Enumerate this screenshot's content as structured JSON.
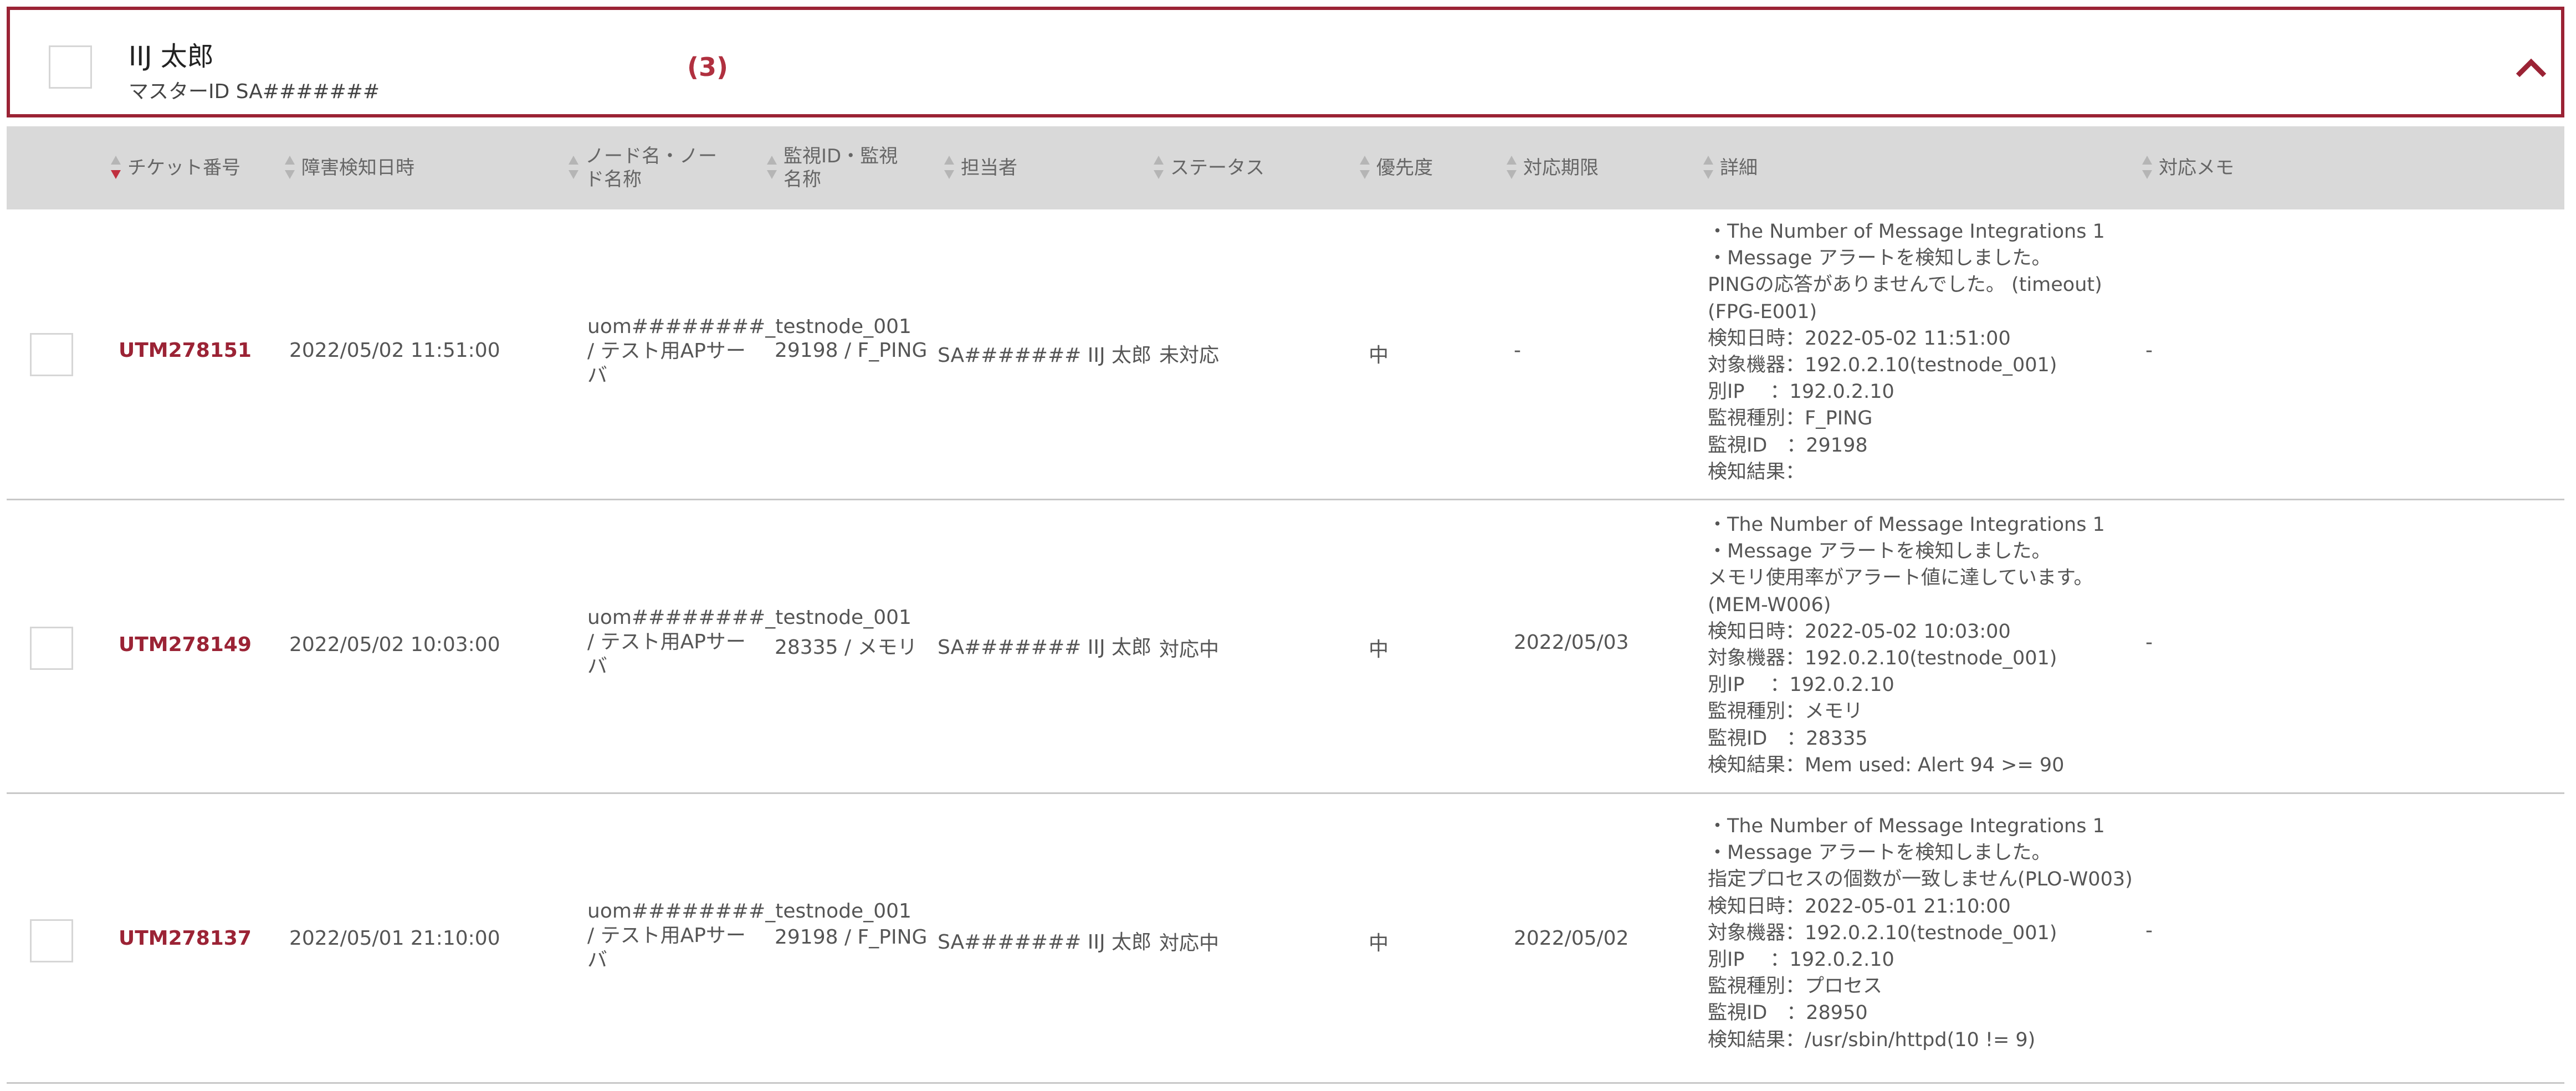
{
  "group": {
    "user_name": "IIJ 太郎",
    "master_id": "マスターID SA#######",
    "count": "(3)"
  },
  "columns": {
    "ticket": "チケット番号",
    "detected_at": "障害検知日時",
    "node": "ノード名・ノード名称",
    "monitor": "監視ID・監視名称",
    "assignee": "担当者",
    "status": "ステータス",
    "priority": "優先度",
    "deadline": "対応期限",
    "detail": "詳細",
    "memo": "対応メモ"
  },
  "rows": [
    {
      "ticket": "UTM278151",
      "detected_at": "2022/05/02 11:51:00",
      "node": "uom########_testnode_001 / テスト用APサーバ",
      "monitor": "29198 / F_PING",
      "assignee": "SA####### IIJ 太郎",
      "status": "未対応",
      "priority": "中",
      "deadline": "-",
      "detail": "・The Number of Message Integrations 1\n・Message アラートを検知しました。\nPINGの応答がありませんでした。 (timeout)\n(FPG-E001)\n検知日時：2022-05-02 11:51:00\n対象機器：192.0.2.10(testnode_001)\n別IP　 ：192.0.2.10\n監視種別：F_PING\n監視ID　：29198\n検知結果：",
      "memo": "-"
    },
    {
      "ticket": "UTM278149",
      "detected_at": "2022/05/02 10:03:00",
      "node": "uom########_testnode_001 / テスト用APサーバ",
      "monitor": "28335 / メモリ",
      "assignee": "SA####### IIJ 太郎",
      "status": "対応中",
      "priority": "中",
      "deadline": "2022/05/03",
      "detail": "・The Number of Message Integrations 1\n・Message アラートを検知しました。\nメモリ使用率がアラート値に達しています。\n(MEM-W006)\n検知日時：2022-05-02 10:03:00\n対象機器：192.0.2.10(testnode_001)\n別IP　 ：192.0.2.10\n監視種別：メモリ\n監視ID　：28335\n検知結果：Mem used: Alert 94 >= 90",
      "memo": "-"
    },
    {
      "ticket": "UTM278137",
      "detected_at": "2022/05/01 21:10:00",
      "node": "uom########_testnode_001 / テスト用APサーバ",
      "monitor": "29198 / F_PING",
      "assignee": "SA####### IIJ 太郎",
      "status": "対応中",
      "priority": "中",
      "deadline": "2022/05/02",
      "detail": "・The Number of Message Integrations 1\n・Message アラートを検知しました。\n指定プロセスの個数が一致しません(PLO-W003)\n検知日時：2022-05-01 21:10:00\n対象機器：192.0.2.10(testnode_001)\n別IP　 ：192.0.2.10\n監視種別：プロセス\n監視ID　：28950\n検知結果：/usr/sbin/httpd(10 != 9)",
      "memo": "-"
    }
  ],
  "colors": {
    "accent": "#9b2335",
    "header_bg": "#d9d9d9",
    "sort_active": "#c0303f"
  }
}
